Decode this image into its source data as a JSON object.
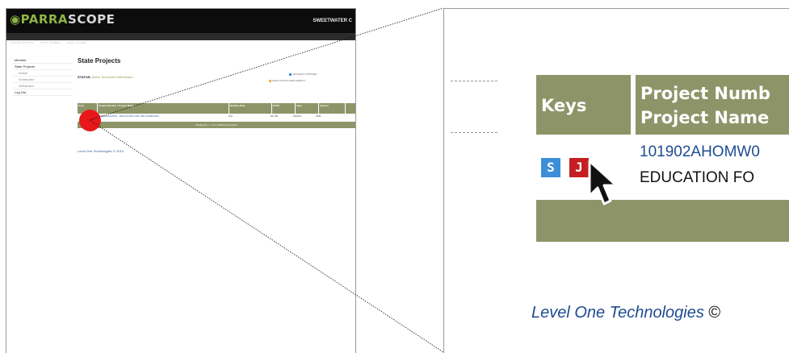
{
  "thumbnail": {
    "logo": {
      "prefix": "PARRA",
      "suffix": "SCOPE"
    },
    "client": "SWEETWATER C",
    "nav_items": [
      "SYSTEM OPTIONS",
      "PRINT SCREEN",
      "HELP / GUIDES"
    ],
    "sidebar": [
      {
        "label": "Member",
        "sub": false
      },
      {
        "label": "State Projects",
        "sub": false
      },
      {
        "label": "Active",
        "sub": true
      },
      {
        "label": "Scheduled",
        "sub": true
      },
      {
        "label": "Withdrawn",
        "sub": true
      },
      {
        "label": "Log Out",
        "sub": false
      }
    ],
    "page_title": "State Projects",
    "status_label": "STATUS:",
    "status_values": "Active  Scheduled  Withdrawn",
    "legend_line1": "ADVISORY  NOTIFIED",
    "legend_line2": "LEAD LINTOS  LEAD AGENCY",
    "table_headers": [
      "Keys",
      "Project Number / Project Name",
      "Bidding Date",
      "CFDA",
      "Type",
      "Agency"
    ],
    "table_row": [
      "",
      "101902AHOMW0...  EDUCATION FOR THE HOMELESS",
      "N/A",
      "84.196",
      "GRANT",
      "CDE"
    ],
    "table_footer": "Displaying 1 - 1 of 1 Matching Projects",
    "footer_text": "Level One Technologies © 2010"
  },
  "zoom": {
    "keys_header": "Keys",
    "project_header_line1": "Project Numb",
    "project_header_line2": "Project Name",
    "badge_s": "S",
    "badge_j": "J",
    "project_number": "101902AHOMW0",
    "project_name": "EDUCATION FO",
    "footer_company": "Level One Technologies",
    "footer_copyright": "©"
  },
  "colors": {
    "olive_header": "#8d9568",
    "link_blue": "#1f4b91",
    "badge_blue": "#3c8fd8",
    "badge_red": "#c41e23",
    "highlight_dot": "#e8171b"
  },
  "icons": [
    "mouse-cursor-icon",
    "s-key-icon",
    "j-key-icon",
    "parrascope-logo-icon"
  ]
}
